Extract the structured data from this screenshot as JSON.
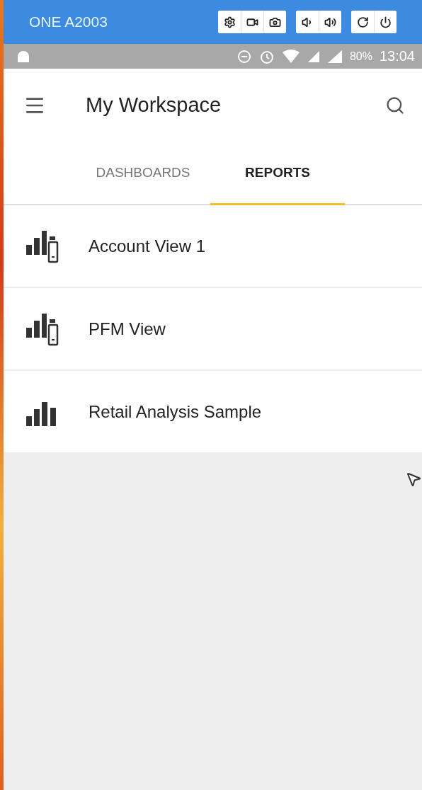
{
  "emulator": {
    "title": "ONE A2003"
  },
  "status_bar": {
    "battery": "80%",
    "time": "13:04"
  },
  "app_bar": {
    "title": "My Workspace"
  },
  "tabs": [
    {
      "label": "DASHBOARDS",
      "selected": false
    },
    {
      "label": "REPORTS",
      "selected": true
    }
  ],
  "reports": [
    {
      "name": "Account View 1",
      "kind": "mobile"
    },
    {
      "name": "PFM View",
      "kind": "mobile"
    },
    {
      "name": "Retail Analysis Sample",
      "kind": "standard"
    }
  ]
}
